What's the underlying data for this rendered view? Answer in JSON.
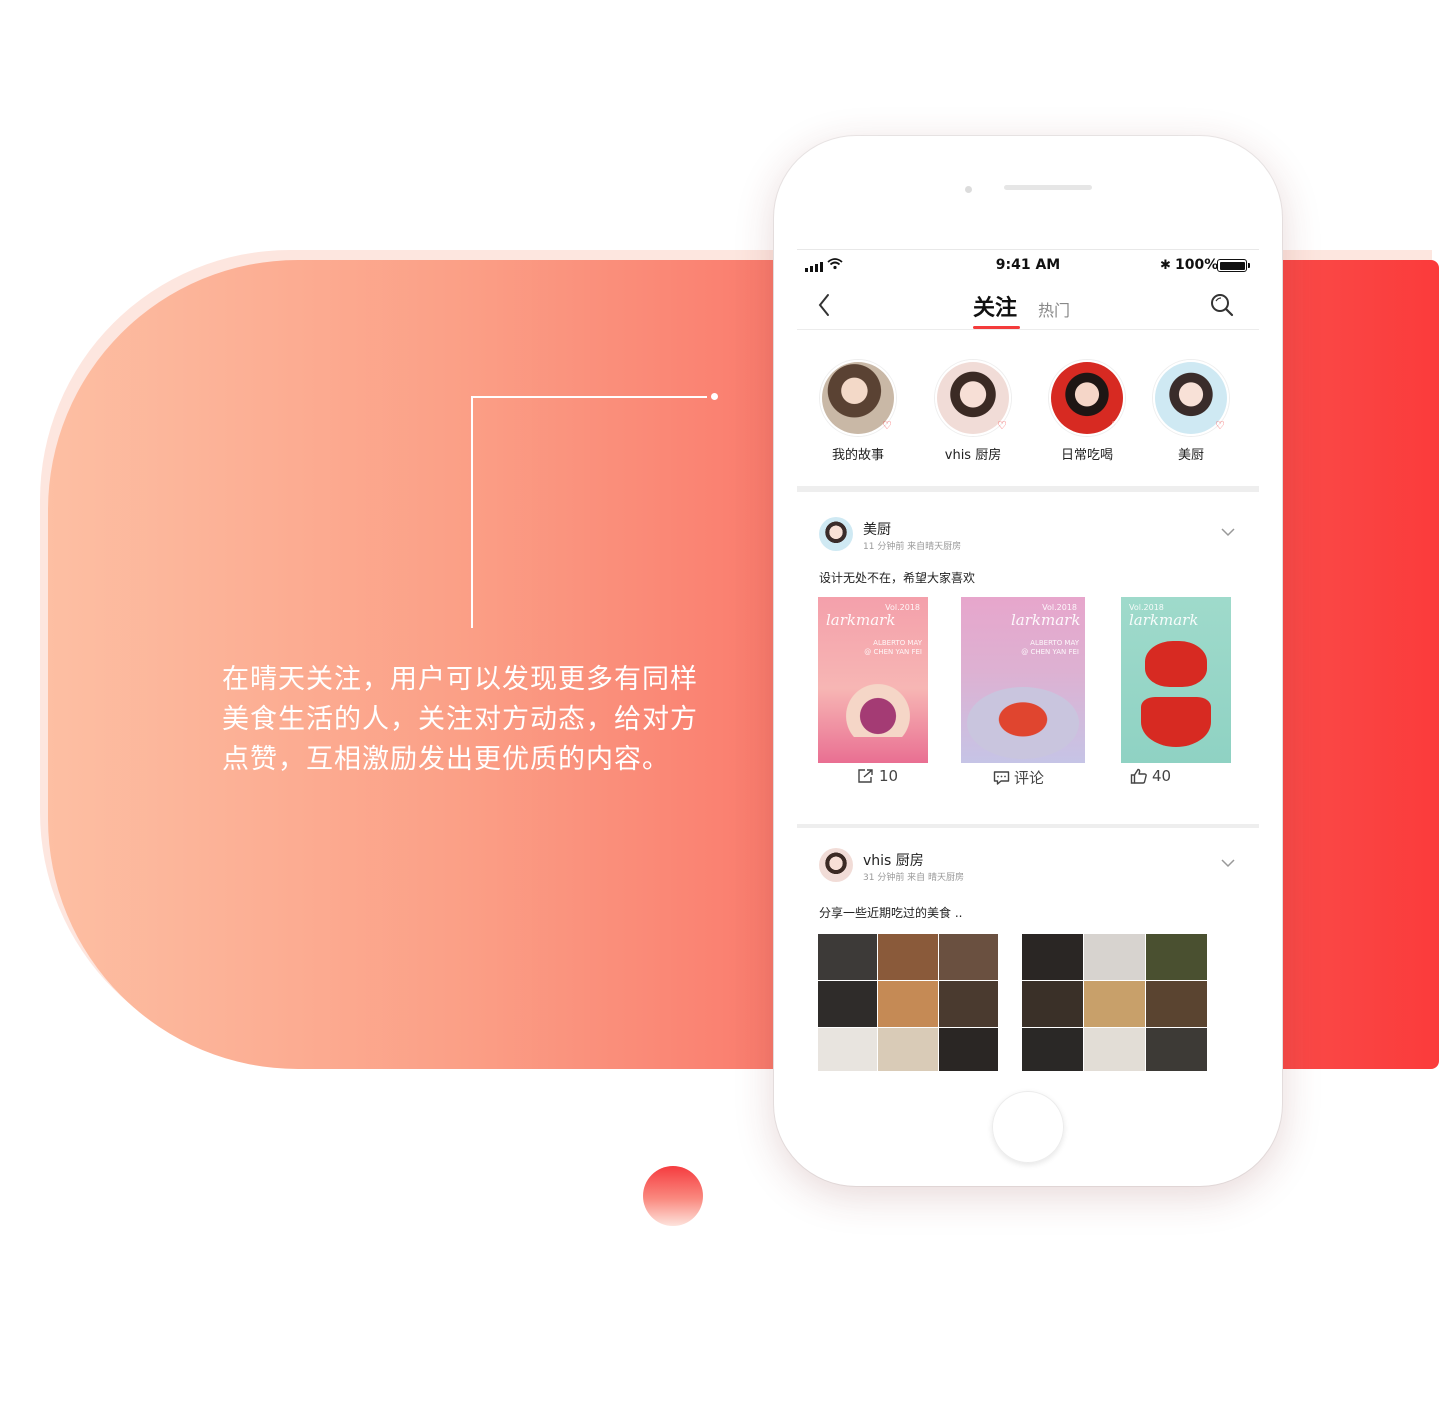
{
  "marketing": {
    "description": "在晴天关注，用户可以发现更多有同样美食生活的人，关注对方动态，给对方点赞，互相激励发出更优质的内容。"
  },
  "status_bar": {
    "time": "9:41 AM",
    "battery": "100%"
  },
  "nav": {
    "tab_follow": "关注",
    "tab_hot": "热门"
  },
  "stories": [
    {
      "label": "我的故事",
      "color": "#8a6a55"
    },
    {
      "label": "vhis 厨房",
      "color": "#e9c9c1"
    },
    {
      "label": "日常吃喝",
      "color": "#d72a22"
    },
    {
      "label": "美厨",
      "color": "#cfe9f3"
    }
  ],
  "posts": [
    {
      "author": "美厨",
      "meta": "11 分钟前 来自晴天厨房",
      "text": "设计无处不在，希望大家喜欢",
      "magazines": [
        {
          "vol": "Vol.2018",
          "brand": "larkmark",
          "credit": "ALBERTO MAY\n@ CHEN YAN FEI",
          "bg": "#f6a3ad",
          "accent": "#b2467a"
        },
        {
          "vol": "Vol.2018",
          "brand": "larkmark",
          "credit": "ALBERTO MAY\n@ CHEN YAN FEI",
          "bg": "#e7a9c9",
          "accent": "#e0452f"
        },
        {
          "vol": "Vol.2018",
          "brand": "larkmark",
          "credit": "",
          "bg": "#9ed8c9",
          "accent": "#d72a22"
        }
      ],
      "share_count": "10",
      "comment_label": "评论",
      "like_count": "40"
    },
    {
      "author": "vhis 厨房",
      "meta": "31 分钟前 来自 晴天厨房",
      "text": "分享一些近期吃过的美食 .."
    }
  ]
}
